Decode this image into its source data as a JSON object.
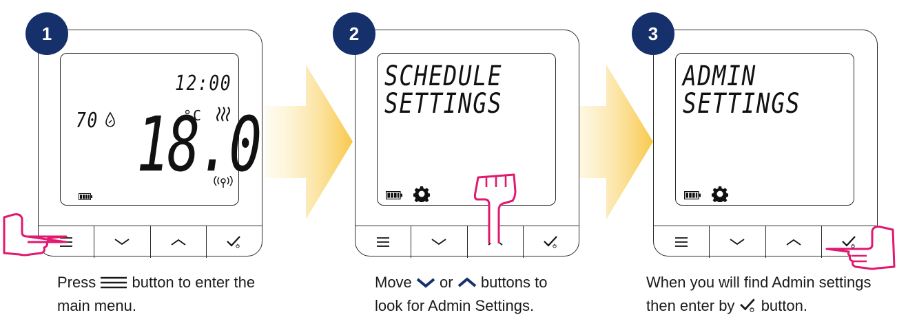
{
  "accent": "#16306b",
  "hand_color": "#e0186f",
  "arrow_color": "#f8c84a",
  "steps": [
    {
      "number": "1",
      "screen": {
        "time": "12:00",
        "humidity": "70",
        "unit": "°C",
        "temperature": "18.0"
      },
      "caption_line1_before": "Press",
      "caption_line1_after": "button to enter the",
      "caption_line2": "main menu."
    },
    {
      "number": "2",
      "screen": {
        "line1": "SCHEDULE",
        "line2": "SETTINGS"
      },
      "caption_line1_before": "Move",
      "caption_line1_mid": "or",
      "caption_line1_after": "buttons to",
      "caption_line2": "look for Admin Settings."
    },
    {
      "number": "3",
      "screen": {
        "line1": "ADMIN",
        "line2": "SETTINGS"
      },
      "caption_line1": "When you will find Admin settings",
      "caption_line2_before": "then enter by",
      "caption_line2_after": "button."
    }
  ],
  "buttons": [
    "menu-icon",
    "chevron-down-icon",
    "chevron-up-icon",
    "check-power-icon"
  ]
}
